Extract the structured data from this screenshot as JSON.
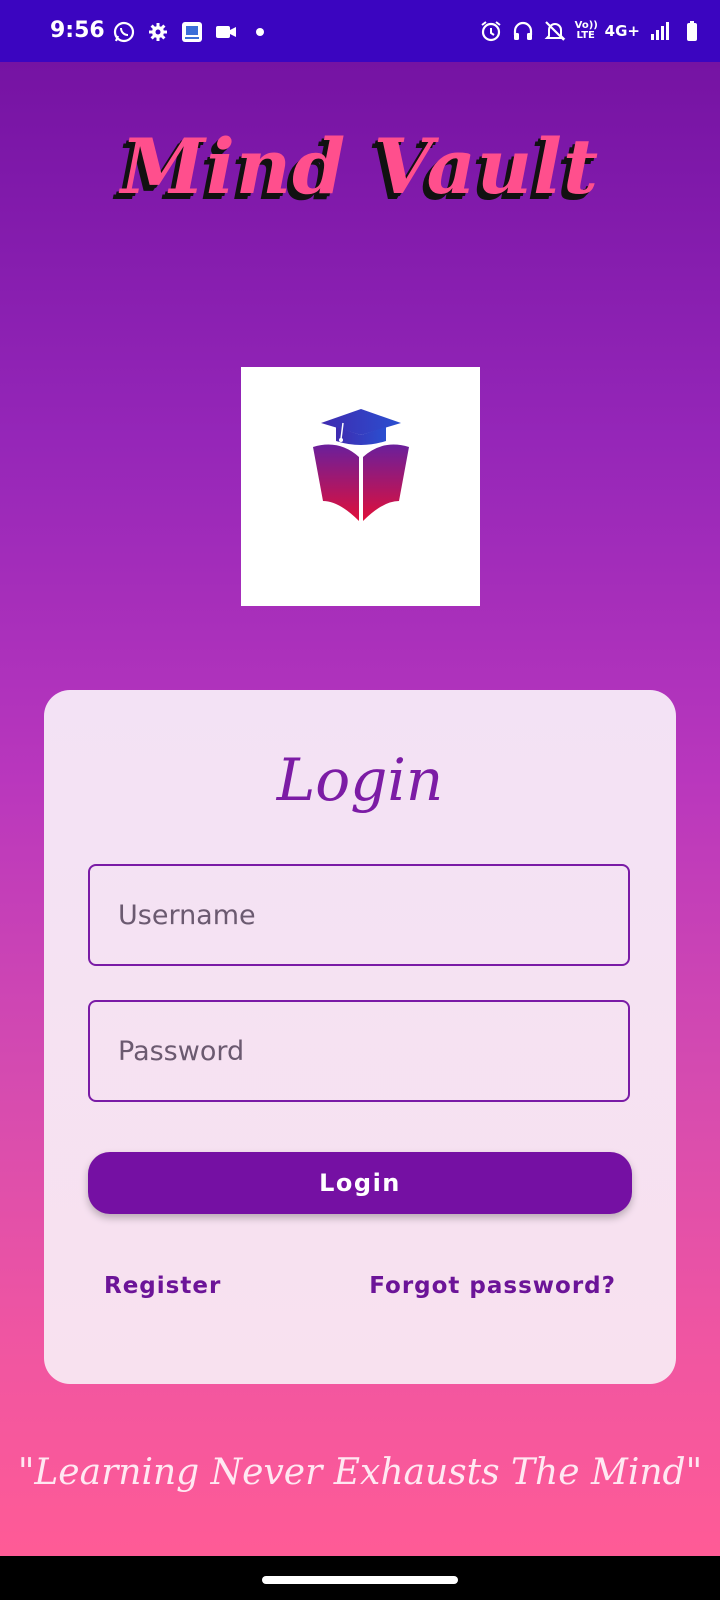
{
  "status_bar": {
    "time": "9:56",
    "network": "4G+",
    "volte_top": "Vo))",
    "volte_bottom": "LTE",
    "left_icons": [
      "whatsapp-icon",
      "settings-gear-icon",
      "app-notification-icon",
      "video-camera-icon",
      "dot-icon"
    ],
    "right_icons": [
      "alarm-icon",
      "headphones-icon",
      "muted-bell-icon",
      "volte-icon",
      "signal-icon",
      "battery-icon"
    ]
  },
  "app": {
    "title": "Mind Vault",
    "logo_icon": "graduation-book-logo"
  },
  "login_card": {
    "title": "Login",
    "username_placeholder": "Username",
    "password_placeholder": "Password",
    "login_button": "Login",
    "register_link": "Register",
    "forgot_link": "Forgot password?"
  },
  "quote": "\"Learning Never Exhausts The Mind\"",
  "colors": {
    "status_bar": "#3b05c0",
    "accent": "#7510a3",
    "title_pink": "#ff4f8d"
  }
}
